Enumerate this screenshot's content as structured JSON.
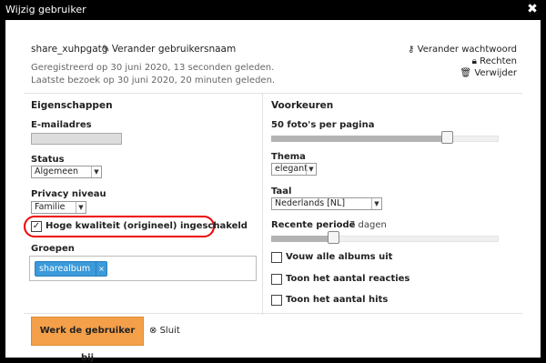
{
  "window": {
    "title": "Wijzig gebruiker",
    "close_glyph": "✖"
  },
  "user": {
    "name": "share_xuhpgatg",
    "rename_label": "Verander gebruikersnaam",
    "registered": "Geregistreerd op 30 juni 2020, 13 seconden geleden.",
    "last_visit": "Laatste bezoek op 30 juni 2020, 20 minuten geleden."
  },
  "actions": {
    "change_password": "Verander wachtwoord",
    "rights": "Rechten",
    "delete": "Verwijder"
  },
  "properties": {
    "title": "Eigenschappen",
    "email_label": "E-mailadres",
    "email_value": "",
    "status_label": "Status",
    "status_value": "Algemeen",
    "privacy_label": "Privacy niveau",
    "privacy_value": "Familie",
    "hq_label": "Hoge kwaliteit (origineel) ingeschakeld",
    "hq_checked": true,
    "groups_label": "Groepen",
    "groups": [
      "sharealbum"
    ],
    "tag_remove_glyph": "×"
  },
  "preferences": {
    "title": "Voorkeuren",
    "photos_per_page_label": "50 foto's per pagina",
    "photos_per_page_value": 50,
    "photos_per_page_fraction": 0.79,
    "theme_label": "Thema",
    "theme_value": "elegant",
    "language_label": "Taal",
    "language_value": "Nederlands [NL]",
    "recent_label": "Recente periode",
    "recent_value": "7 dagen",
    "recent_fraction": 0.26,
    "collapse_albums_label": "Vouw alle albums uit",
    "show_comments_label": "Toon het aantal reacties",
    "show_hits_label": "Toon het aantal hits"
  },
  "footer": {
    "save_label": "Werk de gebruiker bij",
    "close_label": "Sluit"
  },
  "colors": {
    "save_button": "#f4a04a",
    "tag": "#3b9ad9",
    "highlight": "#e00000"
  },
  "icons": {
    "pencil": "pencil-icon",
    "key": "key-icon",
    "lock": "lock-icon",
    "trash": "trash-icon",
    "close_circle": "close-circle-icon"
  }
}
